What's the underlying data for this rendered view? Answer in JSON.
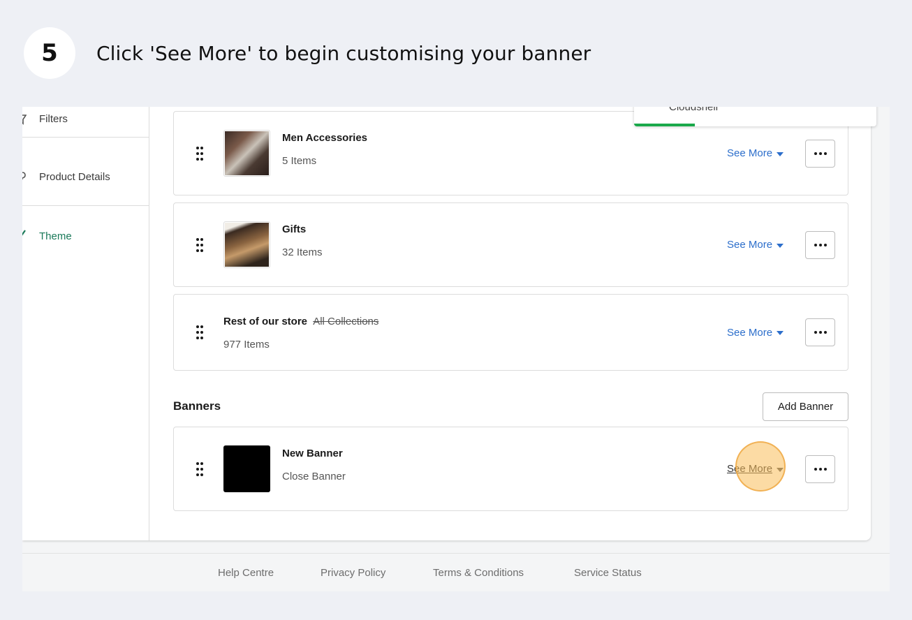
{
  "step": {
    "number": "5",
    "instruction": "Click 'See More' to begin customising your banner"
  },
  "toast": {
    "label": "Cloudshell",
    "progress": 0.25,
    "color": "#1aa84a"
  },
  "sidebar": {
    "items": [
      {
        "label": "Filters",
        "icon": "filter-icon",
        "active": false
      },
      {
        "label": "Product Details",
        "icon": "help-icon",
        "active": false
      },
      {
        "label": "Theme",
        "icon": "brush-icon",
        "active": true
      }
    ]
  },
  "collections": [
    {
      "title": "Men Accessories",
      "count": "5 Items",
      "see_more": "See More",
      "has_thumb": true
    },
    {
      "title": "Gifts",
      "count": "32 Items",
      "see_more": "See More",
      "has_thumb": true
    },
    {
      "title": "Rest of our store",
      "strike": "All Collections",
      "count": "977 Items",
      "see_more": "See More",
      "has_thumb": false
    }
  ],
  "banners": {
    "section_title": "Banners",
    "add_button": "Add Banner",
    "items": [
      {
        "title": "New Banner",
        "subtitle": "Close Banner",
        "see_more": "See More"
      }
    ]
  },
  "footer": {
    "links": [
      "Help Centre",
      "Privacy Policy",
      "Terms & Conditions",
      "Service Status"
    ]
  },
  "colors": {
    "accent": "#2c6ecb",
    "theme_active": "#1b7a5a",
    "highlight": "#fabe5a"
  }
}
